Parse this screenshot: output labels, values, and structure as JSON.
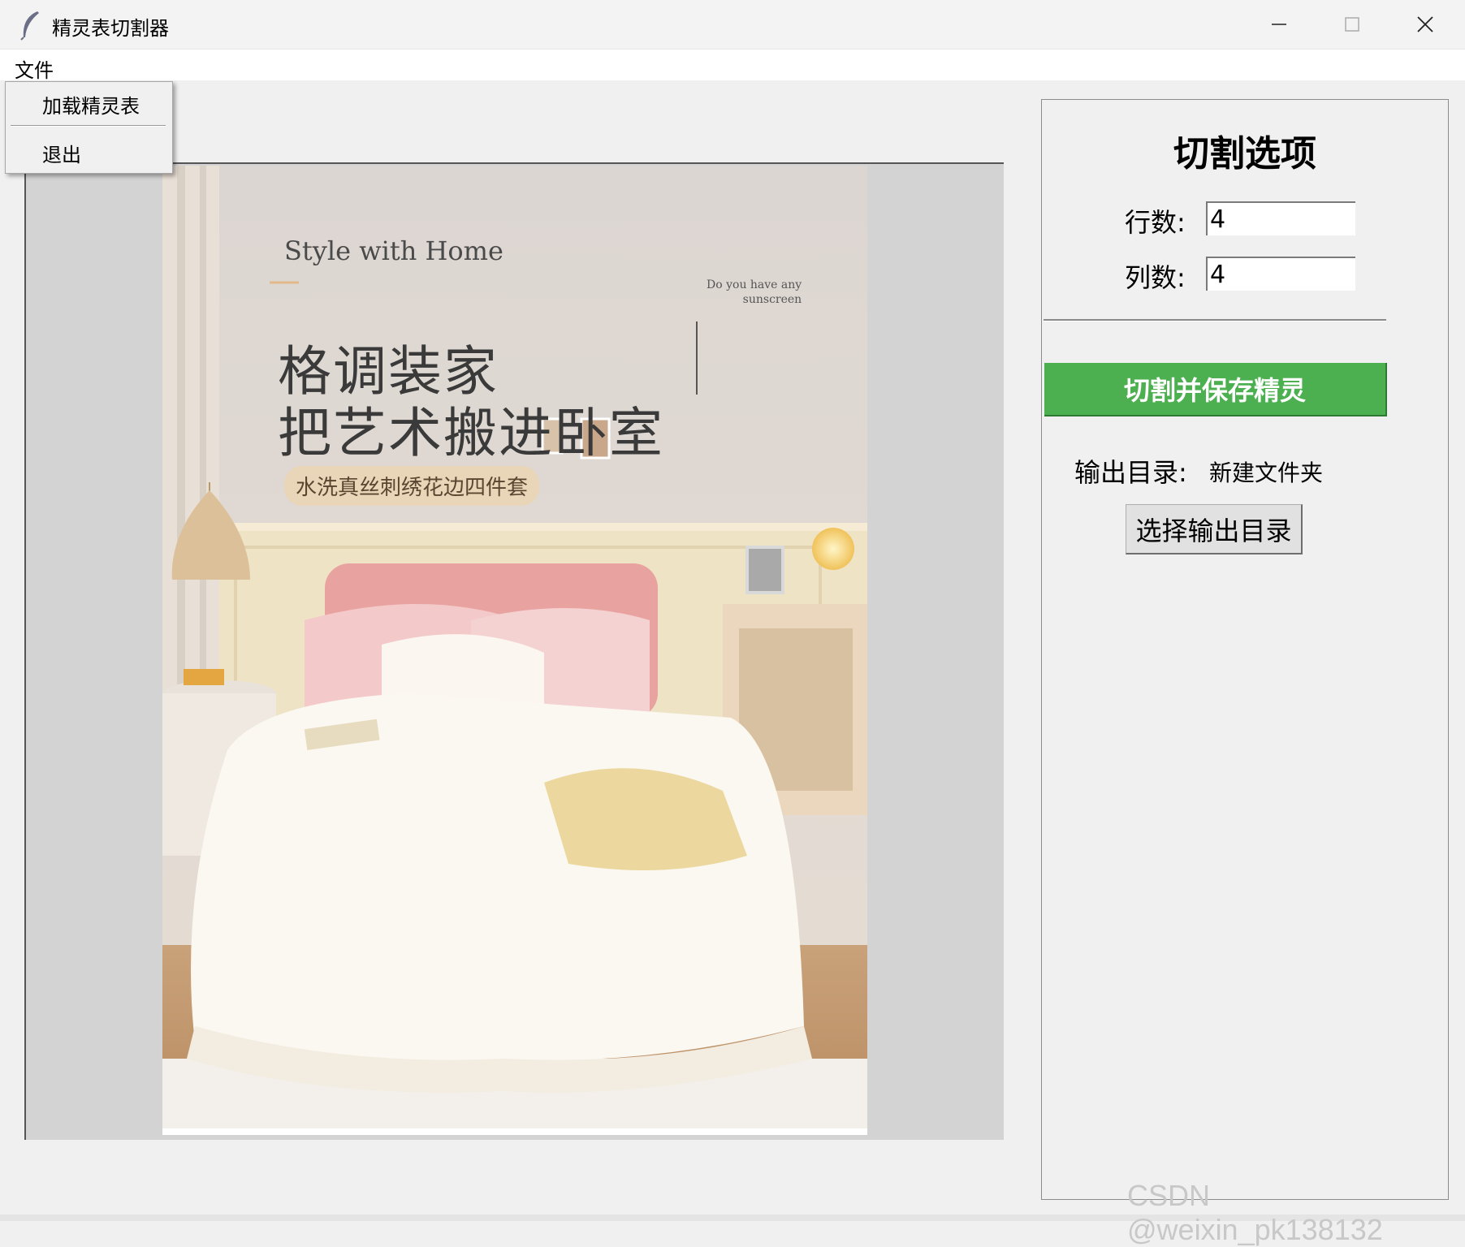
{
  "window": {
    "title": "精灵表切割器"
  },
  "menubar": {
    "file_label": "文件"
  },
  "file_menu": {
    "items": [
      {
        "label": "加载精灵表"
      },
      {
        "label": "退出"
      }
    ]
  },
  "image": {
    "slogan_en": "Style with Home",
    "slogan_line1": "格调装家",
    "slogan_line2": "把艺术搬进卧室",
    "slogan_tag": "水洗真丝刺绣花边四件套",
    "slogan_small_1": "Do you have any",
    "slogan_small_2": "sunscreen"
  },
  "options": {
    "title": "切割选项",
    "rows_label": "行数:",
    "rows_value": "4",
    "cols_label": "列数:",
    "cols_value": "4",
    "slice_button": "切割并保存精灵",
    "output_label": "输出目录:",
    "output_value": "新建文件夹",
    "choose_button": "选择输出目录"
  },
  "colors": {
    "slice_button_bg": "#4caf50",
    "canvas_bg": "#d3d3d3",
    "window_bg": "#f0f0f0"
  },
  "watermark": "CSDN @weixin_pk138132"
}
